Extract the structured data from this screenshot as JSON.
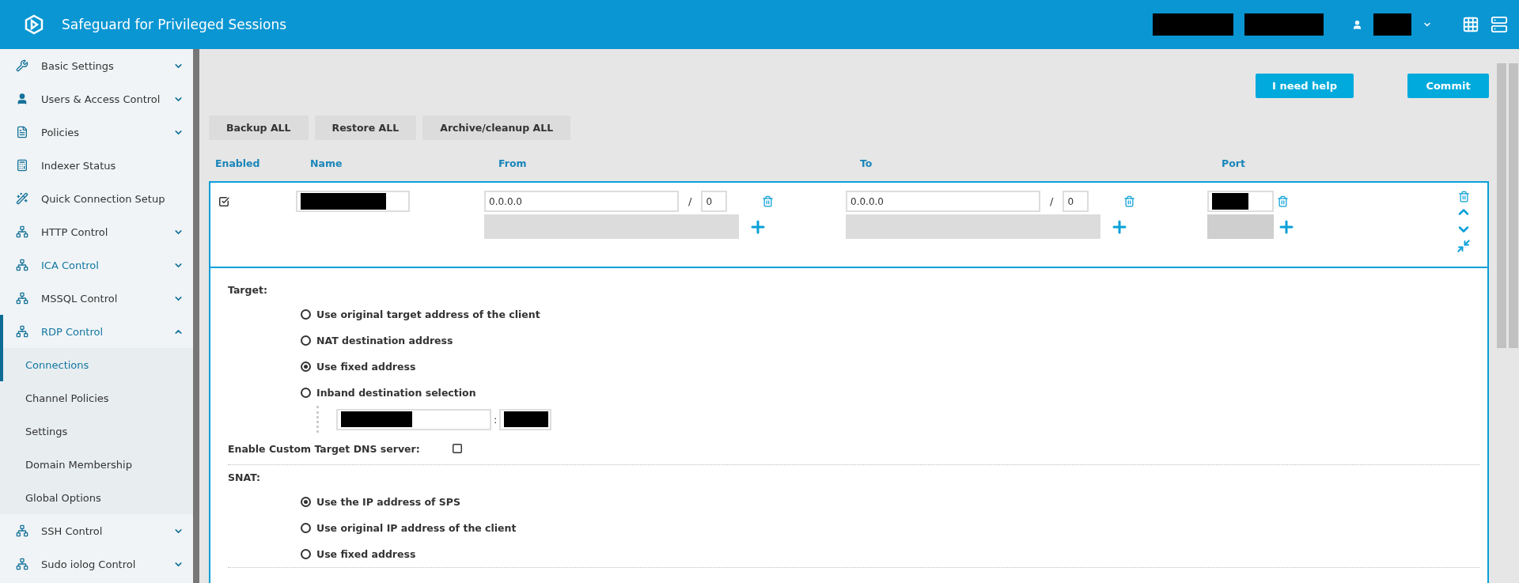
{
  "header": {
    "title": "Safeguard for Privileged Sessions"
  },
  "sidebar": {
    "items": [
      {
        "label": "Basic Settings",
        "kind": "group",
        "expanded": false,
        "active": false
      },
      {
        "label": "Users & Access Control",
        "kind": "group",
        "expanded": false,
        "active": false
      },
      {
        "label": "Policies",
        "kind": "group",
        "expanded": false,
        "active": false
      },
      {
        "label": "Indexer Status",
        "kind": "page",
        "expanded": false,
        "active": false
      },
      {
        "label": "Quick Connection Setup",
        "kind": "page",
        "expanded": false,
        "active": false
      },
      {
        "label": "HTTP Control",
        "kind": "group",
        "expanded": false,
        "active": false
      },
      {
        "label": "ICA Control",
        "kind": "group",
        "expanded": false,
        "active": true
      },
      {
        "label": "MSSQL Control",
        "kind": "group",
        "expanded": false,
        "active": false
      },
      {
        "label": "RDP Control",
        "kind": "group",
        "expanded": true,
        "active": true,
        "children": [
          {
            "label": "Connections",
            "selected": true
          },
          {
            "label": "Channel Policies",
            "selected": false
          },
          {
            "label": "Settings",
            "selected": false
          },
          {
            "label": "Domain Membership",
            "selected": false
          },
          {
            "label": "Global Options",
            "selected": false
          }
        ]
      },
      {
        "label": "SSH Control",
        "kind": "group",
        "expanded": false,
        "active": false
      },
      {
        "label": "Sudo iolog Control",
        "kind": "group",
        "expanded": false,
        "active": false
      }
    ]
  },
  "toolbar": {
    "help_button": "I need help",
    "commit_button": "Commit",
    "actions": [
      "Backup ALL",
      "Restore ALL",
      "Archive/cleanup ALL"
    ]
  },
  "table": {
    "columns": [
      "Enabled",
      "Name",
      "From",
      "To",
      "Port"
    ],
    "row": {
      "enabled": true,
      "from": {
        "address": "0.0.0.0",
        "separator": "/",
        "mask": "0"
      },
      "to": {
        "address": "0.0.0.0",
        "separator": "/",
        "mask": "0"
      }
    }
  },
  "target": {
    "label": "Target:",
    "options": [
      {
        "label": "Use original target address of the client",
        "selected": false
      },
      {
        "label": "NAT destination address",
        "selected": false
      },
      {
        "label": "Use fixed address",
        "selected": true
      },
      {
        "label": "Inband destination selection",
        "selected": false
      }
    ],
    "port_separator": ":"
  },
  "dns": {
    "label": "Enable Custom Target DNS server:",
    "checked": false
  },
  "snat": {
    "label": "SNAT:",
    "options": [
      {
        "label": "Use the IP address of SPS",
        "selected": true
      },
      {
        "label": "Use original IP address of the client",
        "selected": false
      },
      {
        "label": "Use fixed address",
        "selected": false
      }
    ]
  }
}
